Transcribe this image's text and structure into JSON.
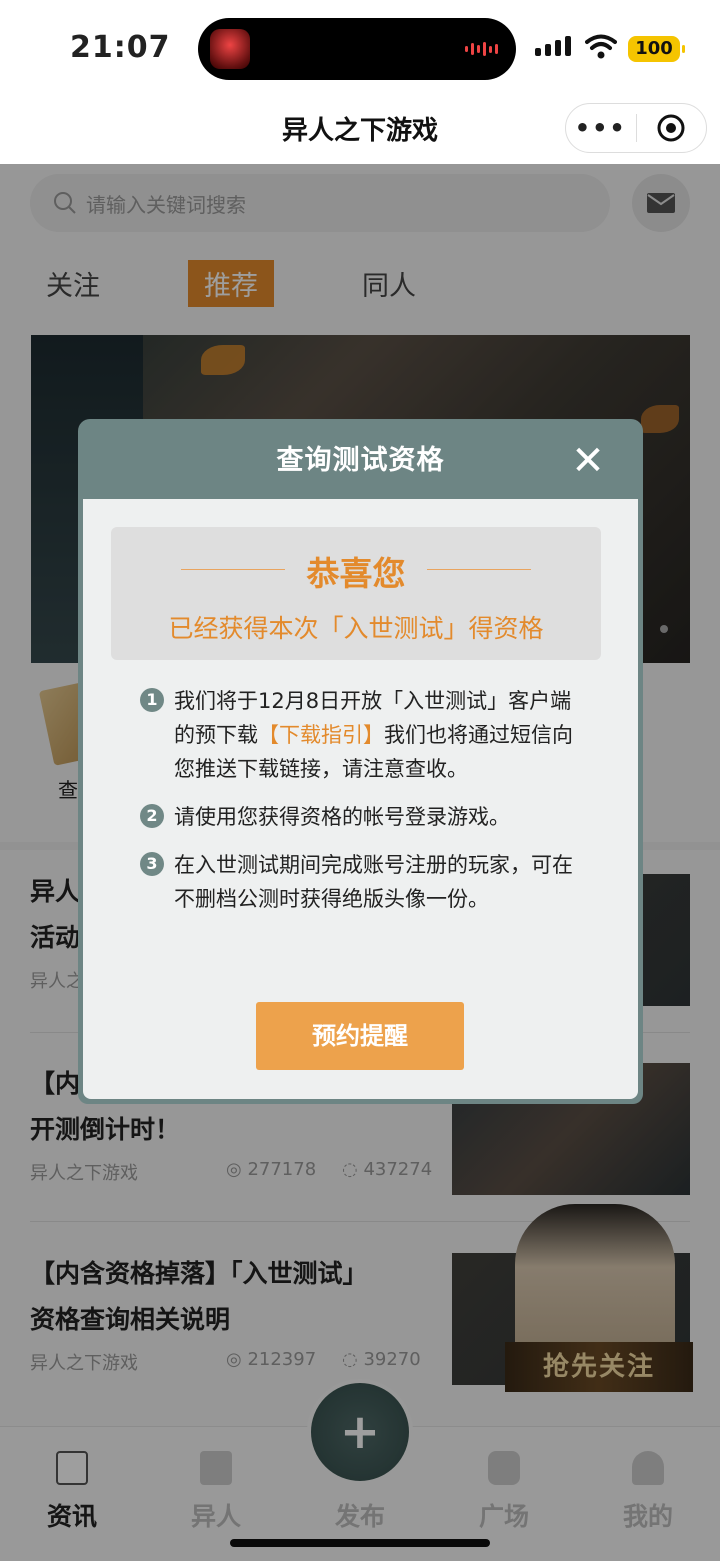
{
  "status_bar": {
    "time": "21:07",
    "battery": "100"
  },
  "navbar": {
    "title": "异人之下游戏"
  },
  "search": {
    "placeholder": "请输入关键词搜索"
  },
  "tabs": [
    {
      "label": "关注"
    },
    {
      "label": "推荐"
    },
    {
      "label": "同人"
    }
  ],
  "quick_entry": {
    "label": "查询测试资格",
    "visible_label": "查询"
  },
  "news": [
    {
      "title_line1": "异人之下",
      "title_line2": "活动",
      "source": "异人之"
    },
    {
      "title_line1": "【内",
      "title_line2": "开测倒计时！",
      "source": "异人之下游戏",
      "views": "277178",
      "comments": "437274"
    },
    {
      "title_line1": "【内含资格掉落】「入世测试」",
      "title_line2": "资格查询相关说明",
      "source": "异人之下游戏",
      "views": "212397",
      "comments": "39270"
    }
  ],
  "follow_badge": {
    "label": "抢先关注"
  },
  "tabbar": [
    {
      "label": "资讯"
    },
    {
      "label": "异人"
    },
    {
      "label": "发布"
    },
    {
      "label": "广场"
    },
    {
      "label": "我的"
    }
  ],
  "publish": {
    "symbol": "+"
  },
  "modal": {
    "title": "查询测试资格",
    "close_symbol": "✕",
    "congrats_title": "恭喜您",
    "congrats_sub": "已经获得本次「入世测试」得资格",
    "steps": [
      {
        "num": "1",
        "text_before": "我们将于12月8日开放「入世测试」客户端的预下载",
        "highlight": "【下载指引】",
        "text_after": "我们也将通过短信向您推送下载链接，请注意查收。"
      },
      {
        "num": "2",
        "text": "请使用您获得资格的帐号登录游戏。"
      },
      {
        "num": "3",
        "text": "在入世测试期间完成账号注册的玩家，可在不删档公测时获得绝版头像一份。"
      }
    ],
    "button": "预约提醒"
  },
  "colors": {
    "accent": "#e38a2c",
    "modal_header": "#6d8584",
    "button": "#eda24c"
  }
}
